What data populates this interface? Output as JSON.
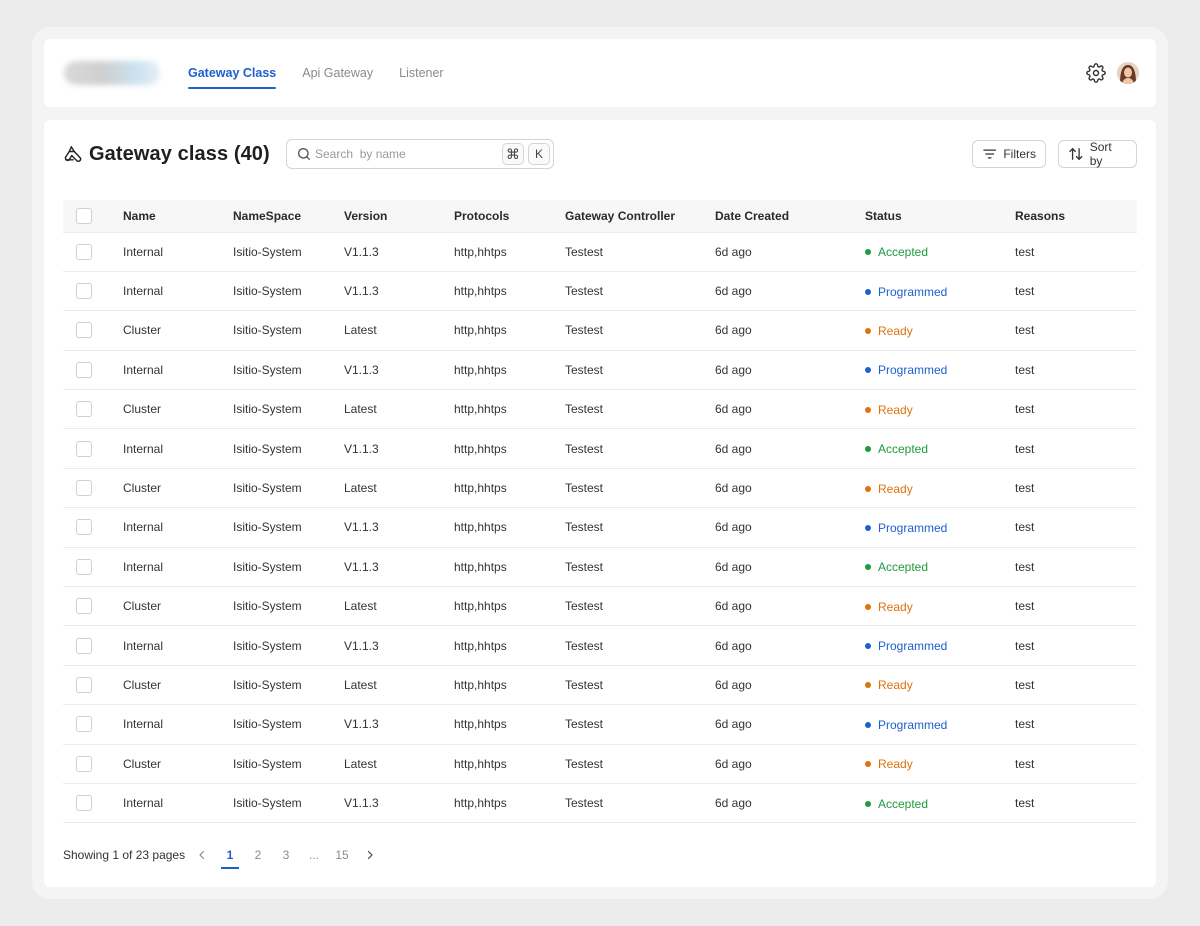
{
  "nav": {
    "tabs": [
      {
        "label": "Gateway Class",
        "active": true
      },
      {
        "label": "Api Gateway",
        "active": false
      },
      {
        "label": "Listener",
        "active": false
      }
    ]
  },
  "page": {
    "title": "Gateway class (40)"
  },
  "search": {
    "placeholder": "Search  by name",
    "shortcut_cmd": "⌘",
    "shortcut_key": "K"
  },
  "toolbar": {
    "filters_label": "Filters",
    "sort_label": "Sort by"
  },
  "table": {
    "columns": [
      "Name",
      "NameSpace",
      "Version",
      "Protocols",
      "Gateway Controller",
      "Date Created",
      "Status",
      "Reasons"
    ],
    "rows": [
      {
        "name": "Internal",
        "namespace": "Isitio-System",
        "version": "V1.1.3",
        "protocols": "http,hhtps",
        "controller": "Testest",
        "created": "6d ago",
        "status": "Accepted",
        "reason": "test"
      },
      {
        "name": "Internal",
        "namespace": "Isitio-System",
        "version": "V1.1.3",
        "protocols": "http,hhtps",
        "controller": "Testest",
        "created": "6d ago",
        "status": "Programmed",
        "reason": "test"
      },
      {
        "name": "Cluster",
        "namespace": "Isitio-System",
        "version": "Latest",
        "protocols": "http,hhtps",
        "controller": "Testest",
        "created": "6d ago",
        "status": "Ready",
        "reason": "test"
      },
      {
        "name": "Internal",
        "namespace": "Isitio-System",
        "version": "V1.1.3",
        "protocols": "http,hhtps",
        "controller": "Testest",
        "created": "6d ago",
        "status": "Programmed",
        "reason": "test"
      },
      {
        "name": "Cluster",
        "namespace": "Isitio-System",
        "version": "Latest",
        "protocols": "http,hhtps",
        "controller": "Testest",
        "created": "6d ago",
        "status": "Ready",
        "reason": "test"
      },
      {
        "name": "Internal",
        "namespace": "Isitio-System",
        "version": "V1.1.3",
        "protocols": "http,hhtps",
        "controller": "Testest",
        "created": "6d ago",
        "status": "Accepted",
        "reason": "test"
      },
      {
        "name": "Cluster",
        "namespace": "Isitio-System",
        "version": "Latest",
        "protocols": "http,hhtps",
        "controller": "Testest",
        "created": "6d ago",
        "status": "Ready",
        "reason": "test"
      },
      {
        "name": "Internal",
        "namespace": "Isitio-System",
        "version": "V1.1.3",
        "protocols": "http,hhtps",
        "controller": "Testest",
        "created": "6d ago",
        "status": "Programmed",
        "reason": "test"
      },
      {
        "name": "Internal",
        "namespace": "Isitio-System",
        "version": "V1.1.3",
        "protocols": "http,hhtps",
        "controller": "Testest",
        "created": "6d ago",
        "status": "Accepted",
        "reason": "test"
      },
      {
        "name": "Cluster",
        "namespace": "Isitio-System",
        "version": "Latest",
        "protocols": "http,hhtps",
        "controller": "Testest",
        "created": "6d ago",
        "status": "Ready",
        "reason": "test"
      },
      {
        "name": "Internal",
        "namespace": "Isitio-System",
        "version": "V1.1.3",
        "protocols": "http,hhtps",
        "controller": "Testest",
        "created": "6d ago",
        "status": "Programmed",
        "reason": "test"
      },
      {
        "name": "Cluster",
        "namespace": "Isitio-System",
        "version": "Latest",
        "protocols": "http,hhtps",
        "controller": "Testest",
        "created": "6d ago",
        "status": "Ready",
        "reason": "test"
      },
      {
        "name": "Internal",
        "namespace": "Isitio-System",
        "version": "V1.1.3",
        "protocols": "http,hhtps",
        "controller": "Testest",
        "created": "6d ago",
        "status": "Programmed",
        "reason": "test"
      },
      {
        "name": "Cluster",
        "namespace": "Isitio-System",
        "version": "Latest",
        "protocols": "http,hhtps",
        "controller": "Testest",
        "created": "6d ago",
        "status": "Ready",
        "reason": "test"
      },
      {
        "name": "Internal",
        "namespace": "Isitio-System",
        "version": "V1.1.3",
        "protocols": "http,hhtps",
        "controller": "Testest",
        "created": "6d ago",
        "status": "Accepted",
        "reason": "test"
      }
    ]
  },
  "status_colors": {
    "Accepted": "#1e9b3d",
    "Programmed": "#1e5fcf",
    "Ready": "#e0710f"
  },
  "pagination": {
    "summary": "Showing 1 of 23 pages",
    "pages": [
      "1",
      "2",
      "3",
      "...",
      "15"
    ],
    "current": "1"
  },
  "icons": {
    "title": "gateway-logo-icon",
    "search": "search-icon",
    "filters": "filter-lines-icon",
    "sort": "sort-arrows-icon",
    "settings": "gear-icon",
    "prev": "chevron-left-icon",
    "next": "chevron-right-icon"
  },
  "accent_color": "#1e5fcf"
}
